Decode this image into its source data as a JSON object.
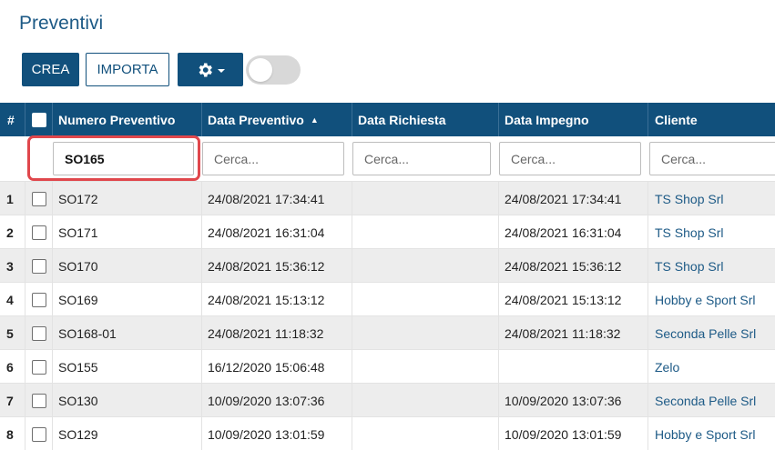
{
  "page": {
    "title": "Preventivi"
  },
  "toolbar": {
    "crea_label": "CREA",
    "importa_label": "IMPORTA",
    "settings_icon": "gear-icon",
    "toggle_on": false
  },
  "table": {
    "columns": [
      "#",
      "Numero Preventivo",
      "Data Preventivo",
      "Data Richiesta",
      "Data Impegno",
      "Cliente"
    ],
    "sort_indicator": "▲",
    "filters": {
      "numero_value": "SO165",
      "placeholder": "Cerca..."
    },
    "rows": [
      {
        "idx": "1",
        "numero": "SO172",
        "data_preventivo": "24/08/2021 17:34:41",
        "data_richiesta": "",
        "data_impegno": "24/08/2021 17:34:41",
        "cliente": "TS Shop Srl"
      },
      {
        "idx": "2",
        "numero": "SO171",
        "data_preventivo": "24/08/2021 16:31:04",
        "data_richiesta": "",
        "data_impegno": "24/08/2021 16:31:04",
        "cliente": "TS Shop Srl"
      },
      {
        "idx": "3",
        "numero": "SO170",
        "data_preventivo": "24/08/2021 15:36:12",
        "data_richiesta": "",
        "data_impegno": "24/08/2021 15:36:12",
        "cliente": "TS Shop Srl"
      },
      {
        "idx": "4",
        "numero": "SO169",
        "data_preventivo": "24/08/2021 15:13:12",
        "data_richiesta": "",
        "data_impegno": "24/08/2021 15:13:12",
        "cliente": "Hobby e Sport Srl"
      },
      {
        "idx": "5",
        "numero": "SO168-01",
        "data_preventivo": "24/08/2021 11:18:32",
        "data_richiesta": "",
        "data_impegno": "24/08/2021 11:18:32",
        "cliente": "Seconda Pelle Srl"
      },
      {
        "idx": "6",
        "numero": "SO155",
        "data_preventivo": "16/12/2020 15:06:48",
        "data_richiesta": "",
        "data_impegno": "",
        "cliente": "Zelo"
      },
      {
        "idx": "7",
        "numero": "SO130",
        "data_preventivo": "10/09/2020 13:07:36",
        "data_richiesta": "",
        "data_impegno": "10/09/2020 13:07:36",
        "cliente": "Seconda Pelle Srl"
      },
      {
        "idx": "8",
        "numero": "SO129",
        "data_preventivo": "10/09/2020 13:01:59",
        "data_richiesta": "",
        "data_impegno": "10/09/2020 13:01:59",
        "cliente": "Hobby e Sport Srl"
      }
    ]
  },
  "colors": {
    "header_bg": "#11507c",
    "link": "#1d5a86",
    "highlight": "#e0474c",
    "odd_row": "#ededed"
  }
}
